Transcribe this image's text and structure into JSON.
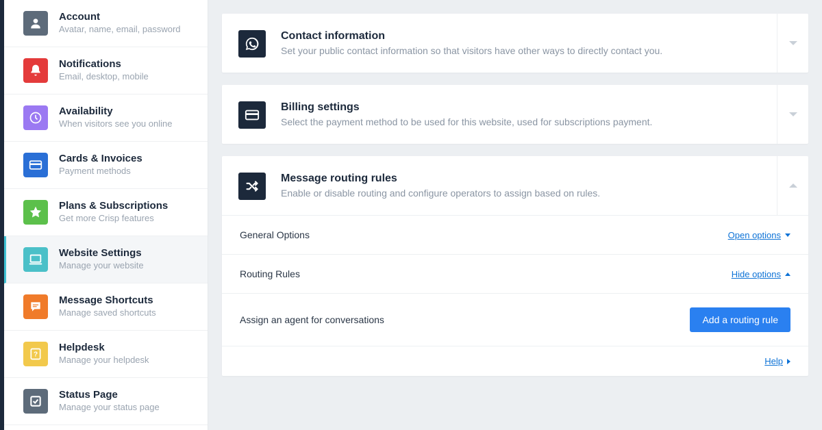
{
  "sidebar": {
    "items": [
      {
        "title": "Account",
        "subtitle": "Avatar, name, email, password",
        "color": "#5d6b7a",
        "icon": "person"
      },
      {
        "title": "Notifications",
        "subtitle": "Email, desktop, mobile",
        "color": "#e43b3b",
        "icon": "bell"
      },
      {
        "title": "Availability",
        "subtitle": "When visitors see you online",
        "color": "#9b79f2",
        "icon": "clock"
      },
      {
        "title": "Cards & Invoices",
        "subtitle": "Payment methods",
        "color": "#2a6fd6",
        "icon": "card"
      },
      {
        "title": "Plans & Subscriptions",
        "subtitle": "Get more Crisp features",
        "color": "#5cc04b",
        "icon": "star"
      },
      {
        "title": "Website Settings",
        "subtitle": "Manage your website",
        "color": "#4bc0c8",
        "icon": "laptop",
        "active": true
      },
      {
        "title": "Message Shortcuts",
        "subtitle": "Manage saved shortcuts",
        "color": "#f07b2a",
        "icon": "message"
      },
      {
        "title": "Helpdesk",
        "subtitle": "Manage your helpdesk",
        "color": "#f2c94c",
        "icon": "help"
      },
      {
        "title": "Status Page",
        "subtitle": "Manage your status page",
        "color": "#5d6b7a",
        "icon": "check"
      }
    ]
  },
  "main": {
    "contact": {
      "title": "Contact information",
      "desc": "Set your public contact information so that visitors have other ways to directly contact you."
    },
    "billing": {
      "title": "Billing settings",
      "desc": "Select the payment method to be used for this website, used for subscriptions payment."
    },
    "routing": {
      "title": "Message routing rules",
      "desc": "Enable or disable routing and configure operators to assign based on rules.",
      "general_label": "General Options",
      "general_action": "Open options",
      "rules_label": "Routing Rules",
      "rules_action": "Hide options",
      "assign_label": "Assign an agent for conversations",
      "add_rule_button": "Add a routing rule",
      "help_label": "Help"
    }
  }
}
